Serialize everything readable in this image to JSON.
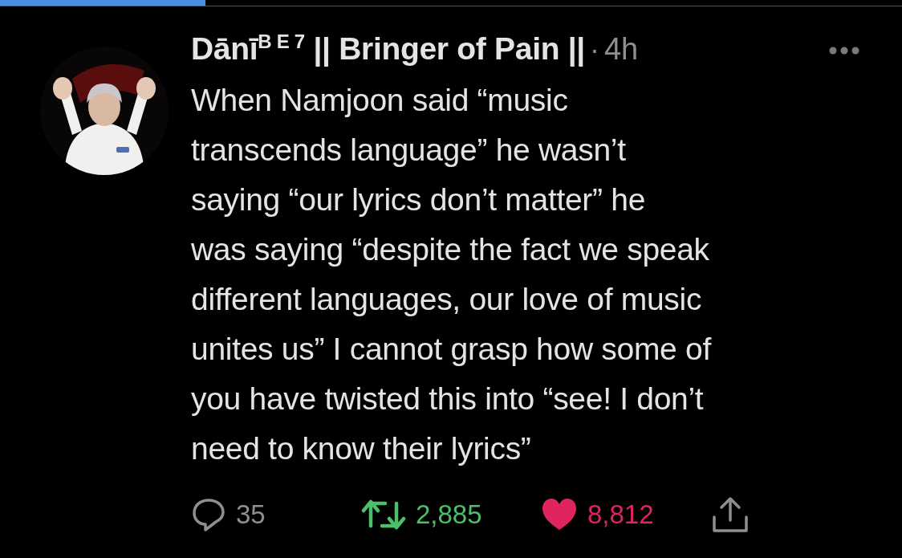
{
  "progress": {
    "level": 0.228
  },
  "tweet": {
    "author": "Dānī$^{B E 7}$ || Bringer of Pain ||",
    "separator": "·",
    "time": "4h",
    "text_lines": [
      "When Namjoon said “music",
      "transcends language” he wasn’t",
      "saying “our lyrics don’t matter” he",
      "was saying “despite the fact we speak",
      "different languages, our love of music",
      "unites us” I cannot grasp how some of",
      "you have twisted this into “see! I don’t",
      "need to know their lyrics”"
    ],
    "actions": [
      {
        "kind": "reply",
        "count": "35"
      },
      {
        "kind": "retweet",
        "count": "2,885"
      },
      {
        "kind": "like",
        "count": "8,812"
      },
      {
        "kind": "share"
      }
    ]
  }
}
